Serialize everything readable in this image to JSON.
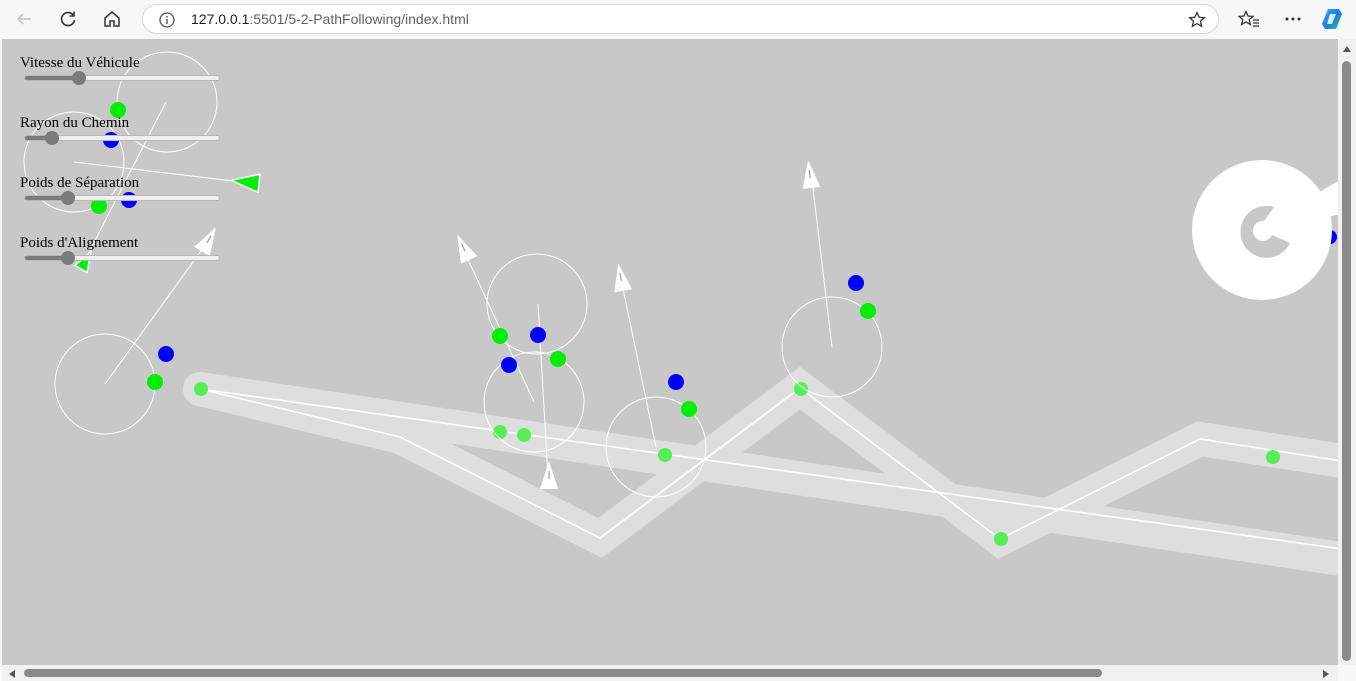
{
  "browser": {
    "url_host": "127.0.0.1",
    "url_rest": ":5501/5-2-PathFollowing/index.html",
    "icons": [
      "back-icon",
      "refresh-icon",
      "home-icon",
      "info-icon",
      "star-icon",
      "favorites-icon",
      "more-icon",
      "copilot-icon"
    ]
  },
  "controls": [
    {
      "label": "Vitesse du Véhicule",
      "value": 0.28
    },
    {
      "label": "Rayon du Chemin",
      "value": 0.14
    },
    {
      "label": "Poids de Séparation",
      "value": 0.22
    },
    {
      "label": "Poids d'Alignement",
      "value": 0.22
    }
  ],
  "colors": {
    "canvas": "#c8c8c8",
    "path_band": "#dedede",
    "path_line": "#ffffff",
    "predict_dot": "#00ee00",
    "target_dot": "#0000ff",
    "vehicle": "#ffffff"
  }
}
